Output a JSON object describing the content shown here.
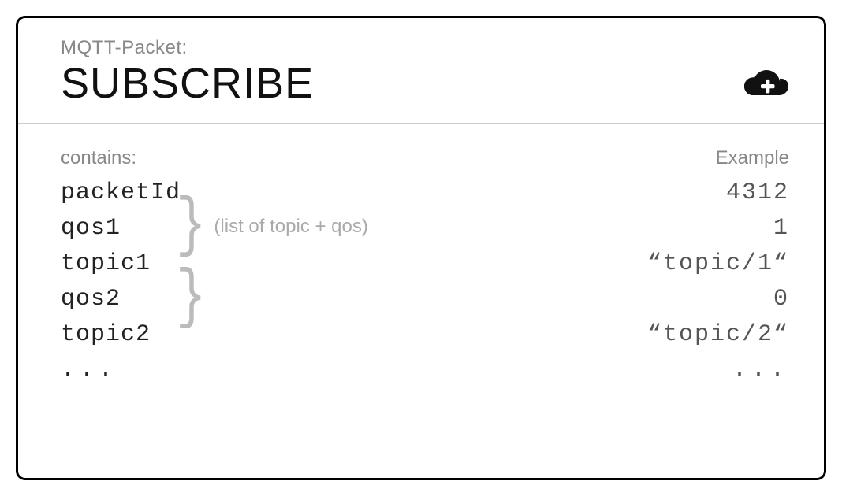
{
  "header": {
    "subtitle": "MQTT-Packet:",
    "title": "SUBSCRIBE"
  },
  "labels": {
    "contains": "contains:",
    "example": "Example"
  },
  "rows": [
    {
      "key": "packetId",
      "value": "4312"
    },
    {
      "key": "qos1",
      "value": "1"
    },
    {
      "key": "topic1",
      "value": "“topic/1“"
    },
    {
      "key": "qos2",
      "value": "0"
    },
    {
      "key": "topic2",
      "value": "“topic/2“"
    },
    {
      "key": "...",
      "value": "..."
    }
  ],
  "annotation": {
    "brace_note": "(list of topic + qos)"
  }
}
